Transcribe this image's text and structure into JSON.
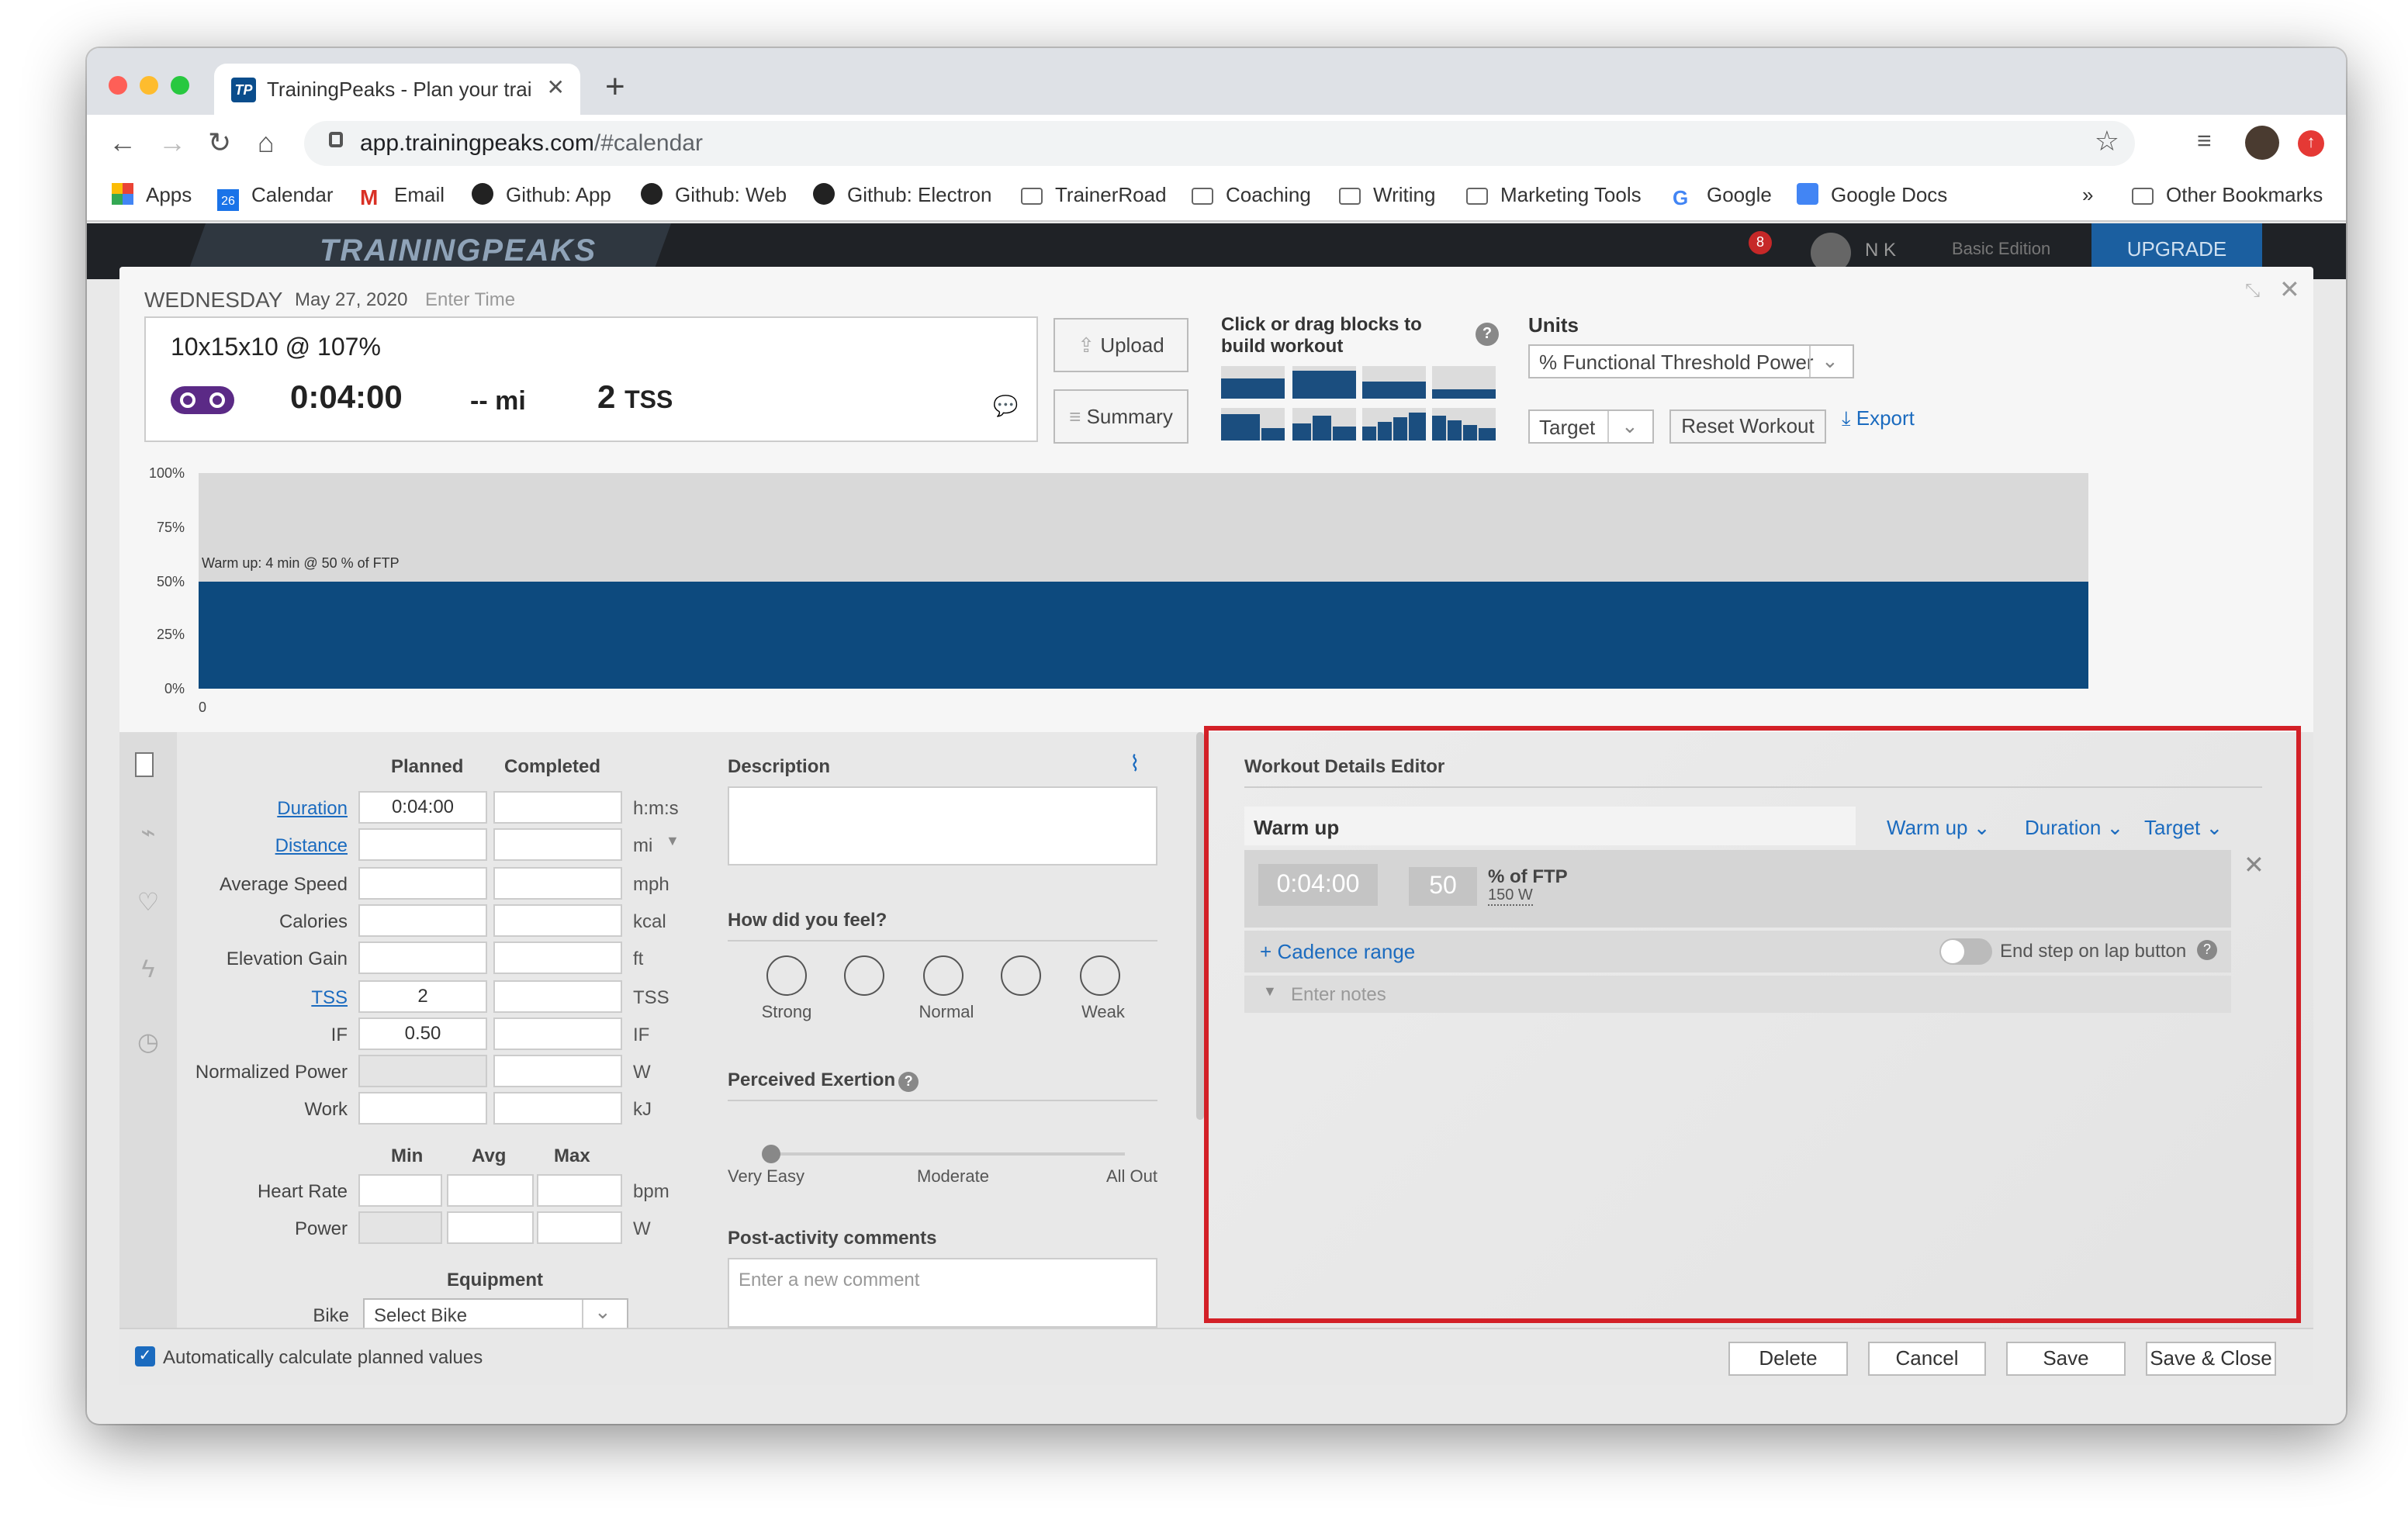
{
  "browser": {
    "tab_title": "TrainingPeaks - Plan your trainin",
    "tab_favicon": "TP",
    "url_host": "app.trainingpeaks.com",
    "url_path": "/#calendar",
    "bookmarks": [
      "Apps",
      "Calendar",
      "Email",
      "Github: App",
      "Github: Web",
      "Github: Electron",
      "TrainerRoad",
      "Coaching",
      "Writing",
      "Marketing Tools",
      "Google",
      "Google Docs"
    ],
    "bookmarks_more": "»",
    "other_bookmarks": "Other Bookmarks",
    "calendar_icon_day": "26"
  },
  "app": {
    "logo": "TRAININGPEAKS",
    "notification_count": "8",
    "user_initials": "N K",
    "edition": "Basic Edition",
    "upgrade": "UPGRADE"
  },
  "workout": {
    "day": "WEDNESDAY",
    "date": "May 27, 2020",
    "time_placeholder": "Enter Time",
    "title": "10x15x10 @ 107%",
    "duration": "0:04:00",
    "distance_value": "--",
    "distance_unit": "mi",
    "tss_value": "2",
    "tss_unit": "TSS",
    "upload": "Upload",
    "summary": "Summary",
    "blocks_label": "Click or drag blocks to build workout",
    "help": "?",
    "units_label": "Units",
    "units_value": "% Functional Threshold Power",
    "target_select": "Target",
    "reset": "Reset Workout",
    "export": "Export"
  },
  "chart": {
    "y_ticks": [
      "100%",
      "75%",
      "50%",
      "25%",
      "0%"
    ],
    "x_start": "0",
    "annotation": "Warm up: 4 min @ 50 % of FTP",
    "accent": "#0d4a7e"
  },
  "chart_data": {
    "type": "area",
    "x": [
      0,
      4
    ],
    "values": [
      50,
      50
    ],
    "ylim": [
      0,
      100
    ],
    "ylabel": "",
    "xlabel": ""
  },
  "metrics": {
    "planned_header": "Planned",
    "completed_header": "Completed",
    "rows": [
      {
        "label": "Duration",
        "planned": "0:04:00",
        "unit": "h:m:s"
      },
      {
        "label": "Distance",
        "planned": "",
        "unit": "mi"
      },
      {
        "label": "Average Speed",
        "planned": "",
        "unit": "mph"
      },
      {
        "label": "Calories",
        "planned": "",
        "unit": "kcal"
      },
      {
        "label": "Elevation Gain",
        "planned": "",
        "unit": "ft"
      },
      {
        "label": "TSS",
        "planned": "2",
        "unit": "TSS"
      },
      {
        "label": "IF",
        "planned": "0.50",
        "unit": "IF"
      },
      {
        "label": "Normalized Power",
        "planned": "",
        "unit": "W"
      },
      {
        "label": "Work",
        "planned": "",
        "unit": "kJ"
      }
    ],
    "minmax_headers": [
      "Min",
      "Avg",
      "Max"
    ],
    "hr_label": "Heart Rate",
    "hr_unit": "bpm",
    "power_label": "Power",
    "power_unit": "W",
    "equipment": "Equipment",
    "bike_label": "Bike",
    "bike_value": "Select Bike"
  },
  "feel": {
    "description": "Description",
    "how_feel": "How did you feel?",
    "faces": [
      "Strong",
      "",
      "Normal",
      "",
      "Weak"
    ],
    "exertion": "Perceived Exertion",
    "exertion_labels": [
      "Very Easy",
      "Moderate",
      "All Out"
    ],
    "comments": "Post-activity comments",
    "comment_placeholder": "Enter a new comment"
  },
  "editor": {
    "title": "Workout Details Editor",
    "step_name": "Warm up",
    "step_type": "Warm up",
    "duration_dd": "Duration",
    "target_dd": "Target",
    "duration": "0:04:00",
    "target_value": "50",
    "target_unit": "% of FTP",
    "watts": "150 W",
    "cadence": "Cadence range",
    "end_step": "End step on lap button",
    "notes": "Enter notes"
  },
  "footer": {
    "auto_calc": "Automatically calculate planned values",
    "delete": "Delete",
    "cancel": "Cancel",
    "save": "Save",
    "save_close": "Save & Close"
  }
}
